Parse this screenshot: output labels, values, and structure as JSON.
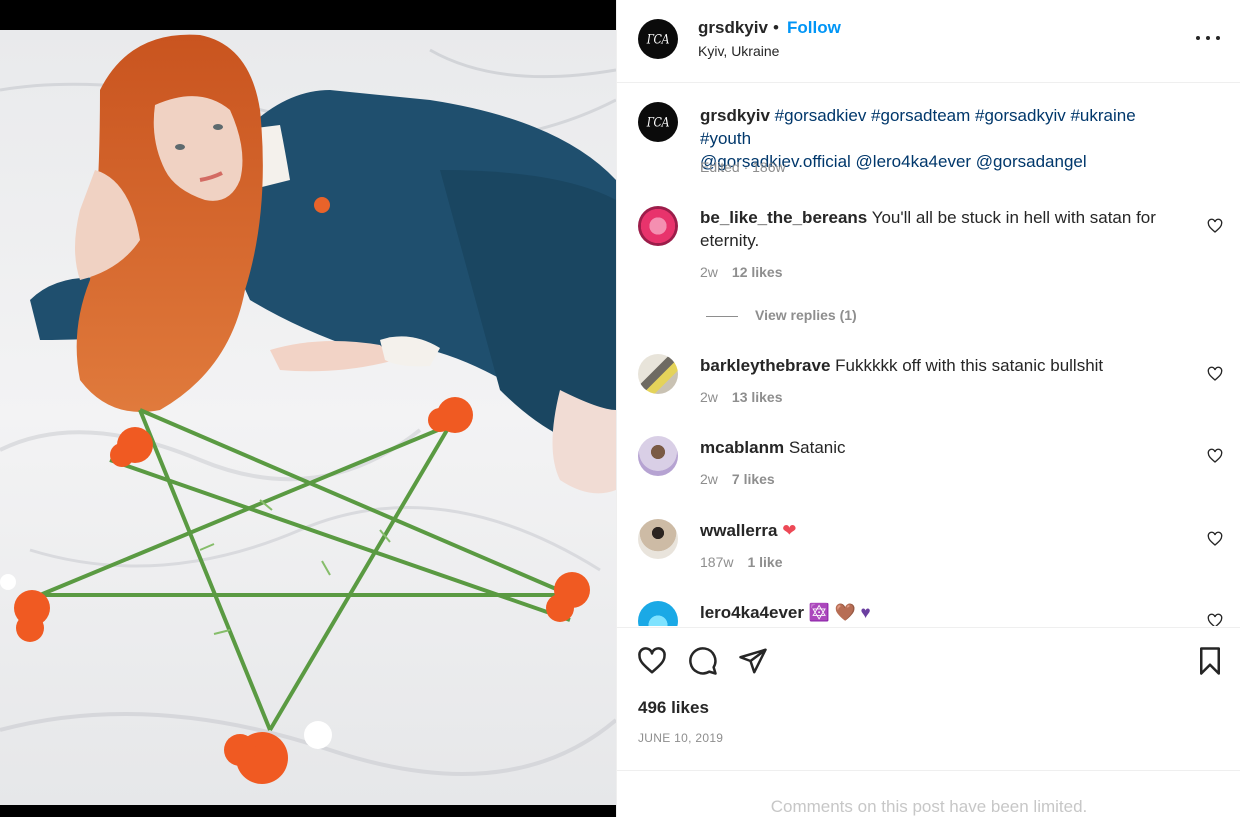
{
  "post": {
    "username": "grsdkyiv",
    "separator": "•",
    "follow_label": "Follow",
    "location": "Kyiv, Ukraine",
    "avatar_logo_text": "ГСА",
    "more_icon": "more-horizontal-icon"
  },
  "caption": {
    "username": "grsdkyiv",
    "line1": "#gorsadkiev #gorsadteam #gorsadkyiv #ukraine #youth",
    "line2": "@gorsadkiev.official @lero4ka4ever @gorsadangel",
    "meta": "Edited · 186w"
  },
  "comments": [
    {
      "username": "be_like_the_bereans",
      "text": "You'll all be stuck in hell with satan for eternity.",
      "age": "2w",
      "likes": "12 likes",
      "view_replies": "View replies (1)",
      "avatar_color": "#e8336c"
    },
    {
      "username": "barkleythebrave",
      "text": "Fukkkkk off with this satanic bullshit",
      "age": "2w",
      "likes": "13 likes",
      "avatar_color": "#c9c2b3"
    },
    {
      "username": "mcablanm",
      "text": "Satanic",
      "age": "2w",
      "likes": "7 likes",
      "avatar_color": "#d9cfe6"
    },
    {
      "username": "wwallerra",
      "text": "❤",
      "age": "187w",
      "likes": "1 like",
      "avatar_color": "#cdbba5"
    },
    {
      "username": "lero4ka4ever",
      "text": "🔯 🤎 ♥",
      "avatar_color": "#1aa9e6"
    }
  ],
  "actions": {
    "like_icon": "heart-icon",
    "comment_icon": "comment-icon",
    "share_icon": "paper-plane-icon",
    "save_icon": "bookmark-icon"
  },
  "likes": "496 likes",
  "date": "JUNE 10, 2019",
  "comments_limited": "Comments on this post have been limited.",
  "colors": {
    "link_blue": "#0095f6",
    "hashtag": "#00376b",
    "muted": "#8e8e8e",
    "heart_red": "#ed4956"
  }
}
